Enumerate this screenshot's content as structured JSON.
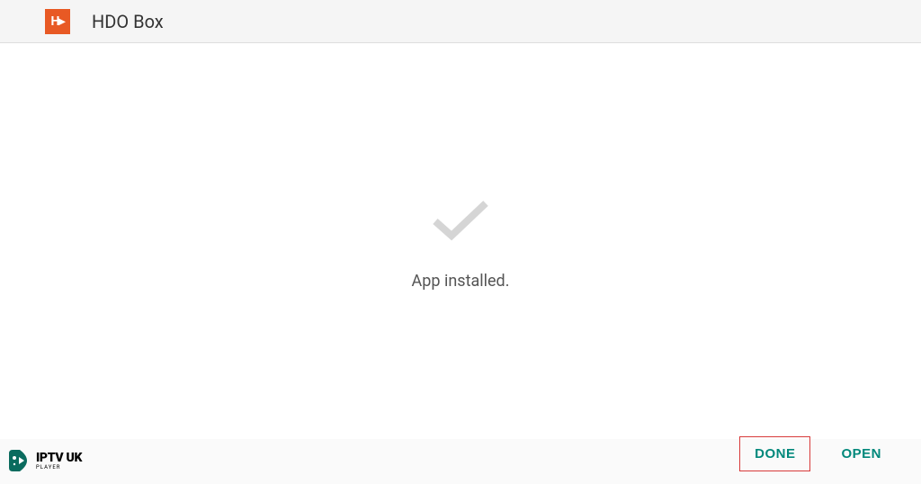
{
  "header": {
    "app_name": "HDO Box",
    "icon_text": "H"
  },
  "main": {
    "status": "App installed."
  },
  "footer": {
    "done_label": "DONE",
    "open_label": "OPEN"
  },
  "watermark": {
    "main": "IPTV UK",
    "sub": "PLAYER"
  },
  "colors": {
    "app_icon_bg": "#e85924",
    "button_text": "#01887b",
    "highlight_border": "#d83a3a",
    "checkmark": "#d5d5d5"
  }
}
